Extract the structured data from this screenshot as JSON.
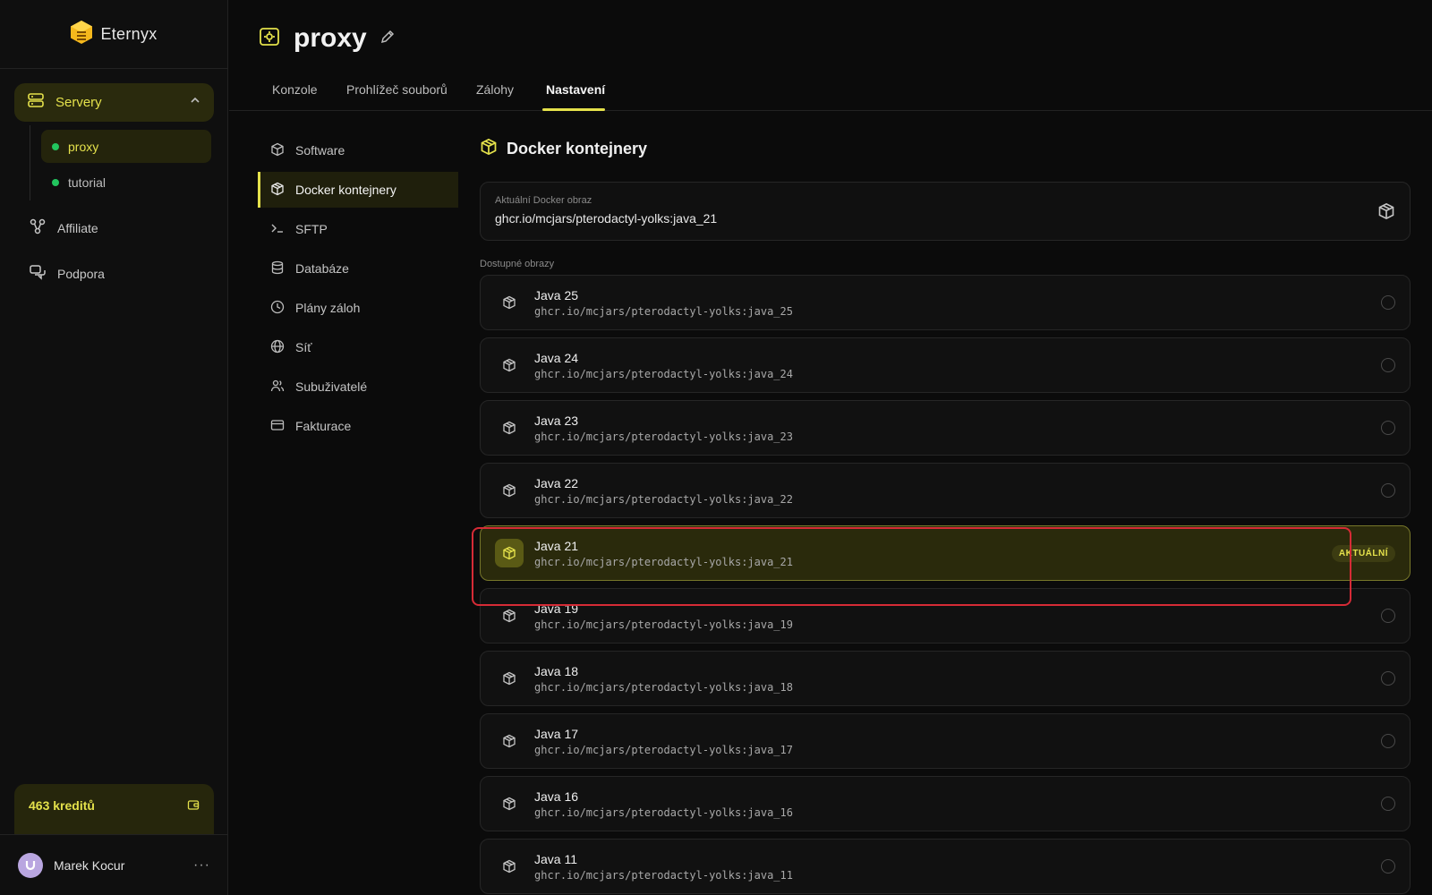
{
  "brand": {
    "name": "Eternyx"
  },
  "sidebar": {
    "group_label": "Servery",
    "servers": [
      {
        "label": "proxy",
        "status_color": "#22c55e"
      },
      {
        "label": "tutorial",
        "status_color": "#22c55e"
      }
    ],
    "items": [
      {
        "label": "Affiliate"
      },
      {
        "label": "Podpora"
      }
    ],
    "credits": "463 kreditů",
    "user_name": "Marek Kocur",
    "more": "···"
  },
  "header": {
    "title": "proxy",
    "tabs": [
      {
        "label": "Konzole"
      },
      {
        "label": "Prohlížeč souborů"
      },
      {
        "label": "Zálohy"
      },
      {
        "label": "Nastavení"
      }
    ]
  },
  "settings_menu": [
    {
      "label": "Software",
      "icon": "box-icon"
    },
    {
      "label": "Docker kontejnery",
      "icon": "cube-icon"
    },
    {
      "label": "SFTP",
      "icon": "terminal-icon"
    },
    {
      "label": "Databáze",
      "icon": "database-icon"
    },
    {
      "label": "Plány záloh",
      "icon": "clock-icon"
    },
    {
      "label": "Síť",
      "icon": "globe-icon"
    },
    {
      "label": "Subuživatelé",
      "icon": "users-icon"
    },
    {
      "label": "Fakturace",
      "icon": "card-icon"
    }
  ],
  "docker": {
    "title": "Docker kontejnery",
    "current_label": "Aktuální Docker obraz",
    "current_value": "ghcr.io/mcjars/pterodactyl-yolks:java_21",
    "available_label": "Dostupné obrazy",
    "current_badge": "AKTUÁLNÍ",
    "images": [
      {
        "name": "Java 25",
        "path": "ghcr.io/mcjars/pterodactyl-yolks:java_25"
      },
      {
        "name": "Java 24",
        "path": "ghcr.io/mcjars/pterodactyl-yolks:java_24"
      },
      {
        "name": "Java 23",
        "path": "ghcr.io/mcjars/pterodactyl-yolks:java_23"
      },
      {
        "name": "Java 22",
        "path": "ghcr.io/mcjars/pterodactyl-yolks:java_22"
      },
      {
        "name": "Java 21",
        "path": "ghcr.io/mcjars/pterodactyl-yolks:java_21"
      },
      {
        "name": "Java 19",
        "path": "ghcr.io/mcjars/pterodactyl-yolks:java_19"
      },
      {
        "name": "Java 18",
        "path": "ghcr.io/mcjars/pterodactyl-yolks:java_18"
      },
      {
        "name": "Java 17",
        "path": "ghcr.io/mcjars/pterodactyl-yolks:java_17"
      },
      {
        "name": "Java 16",
        "path": "ghcr.io/mcjars/pterodactyl-yolks:java_16"
      },
      {
        "name": "Java 11",
        "path": "ghcr.io/mcjars/pterodactyl-yolks:java_11"
      }
    ]
  },
  "colors": {
    "accent": "#e4e14b",
    "online": "#22c55e",
    "annotation": "#d62b36"
  }
}
